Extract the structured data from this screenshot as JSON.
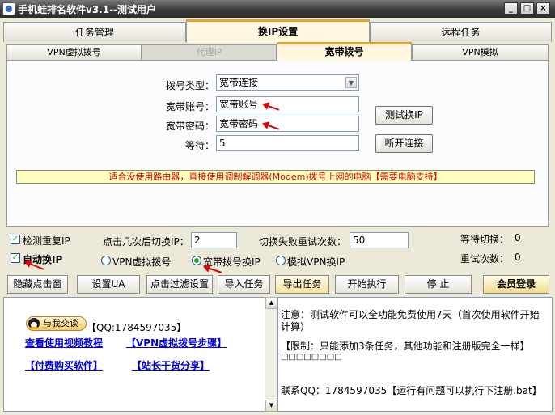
{
  "window": {
    "title": "手机蛙排名软件v3.1--测试用户"
  },
  "main_tabs": [
    {
      "label": "任务管理"
    },
    {
      "label": "换IP设置"
    },
    {
      "label": "远程任务"
    }
  ],
  "sub_tabs": [
    {
      "label": "VPN虚拟拨号"
    },
    {
      "label": "代理IP"
    },
    {
      "label": "宽带拨号"
    },
    {
      "label": "VPN模拟"
    }
  ],
  "broadband": {
    "dial_type_label": "拨号类型：",
    "dial_type_value": "宽带连接",
    "account_label": "宽带账号：",
    "account_value": "宽带账号",
    "password_label": "宽带密码：",
    "password_value": "宽带密码",
    "wait_label": "等待：",
    "wait_value": "5",
    "test_button": "测试换IP",
    "disconnect_button": "断开连接",
    "notice": "适合没使用路由器，直接使用调制解调器(Modem)拨号上网的电脑【需要电脑支持】"
  },
  "options": {
    "check_repeat_ip": "检测重复IP",
    "auto_switch_ip": "自动换IP",
    "clicks_label": "点击几次后切换IP：",
    "clicks_value": "2",
    "retry_label": "切换失败重试次数：",
    "retry_value": "50",
    "radio_vpn": "VPN虚拟拨号",
    "radio_broadband": "宽带拨号换IP",
    "radio_vpn_sim": "模拟VPN换IP",
    "wait_switch_label": "等待切换：",
    "wait_switch_value": "0",
    "retry_count_label": "重试次数：",
    "retry_count_value": "0"
  },
  "toolbar": {
    "hide_window": "隐藏点击窗",
    "set_ua": "设置UA",
    "click_filter": "点击过滤设置",
    "import": "导入任务",
    "export": "导出任务",
    "start": "开始执行",
    "stop": "停 止",
    "login": "会员登录"
  },
  "left_panel": {
    "qq_chat_badge": "与我交谈",
    "qq_text": "【QQ:1784597035】",
    "video_link": "查看使用视频教程",
    "vpn_steps_link": "【VPN虚拟拨号步骤】",
    "buy_link": "【付费购买软件】",
    "share_link": "【站长干货分享】"
  },
  "log_panel": {
    "line1": "注意：测试软件可以全功能免费使用7天（首次使用软件开始计算）",
    "line2": "【限制：只能添加3条任务，其他功能和注册版完全一样】",
    "line3": "□□□□□□□□",
    "line4": "联系QQ：1784597035【运行有问题可以执行下注册.bat】"
  },
  "colors": {
    "active_tab_accent": "#e7a02d",
    "notice_bg": "#ffffc0",
    "notice_text": "#d40000",
    "arrow": "#e00000",
    "link": "#0000cc"
  }
}
